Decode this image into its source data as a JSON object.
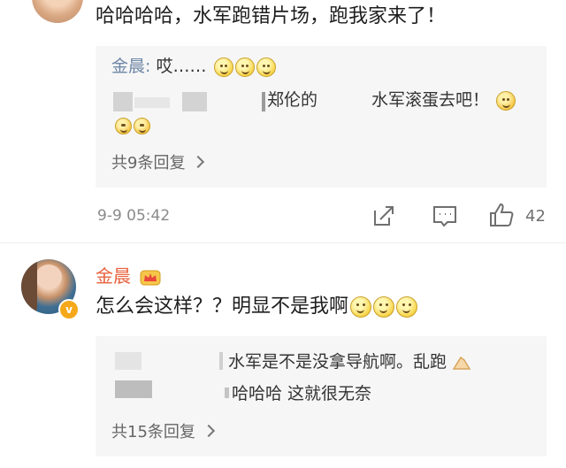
{
  "comment1": {
    "text": "哈哈哈哈，水军跑错片场，跑我家来了！",
    "replies": [
      {
        "name": "金晨",
        "sep": ": ",
        "text": "哎……"
      },
      {
        "text_a": "郑伦的",
        "text_b": "水军滚蛋去吧！"
      }
    ],
    "more_label": "共9条回复",
    "timestamp": "9-9 05:42",
    "like_count": "42"
  },
  "comment2": {
    "author": "金晨",
    "text": "怎么会这样？？明显不是我啊",
    "replies": [
      {
        "text": "水军是不是没拿导航啊。乱跑"
      },
      {
        "text": "哈哈哈 这就很无奈"
      }
    ],
    "more_label": "共15条回复"
  },
  "badge": {
    "vip_letter": "v",
    "color": "#f4a81a"
  },
  "colors": {
    "name_link": "#6e87a7",
    "author_orange": "#e8603c",
    "reply_bg": "#f6f6f6"
  }
}
